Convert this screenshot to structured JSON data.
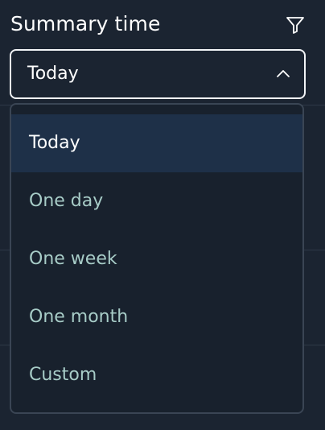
{
  "header": {
    "title": "Summary time",
    "filter_icon": "filter-icon"
  },
  "select": {
    "value": "Today",
    "state": "open",
    "chevron_icon": "chevron-up-icon"
  },
  "dropdown": {
    "options": [
      {
        "label": "Today",
        "selected": true
      },
      {
        "label": "One day",
        "selected": false
      },
      {
        "label": "One week",
        "selected": false
      },
      {
        "label": "One month",
        "selected": false
      },
      {
        "label": "Custom",
        "selected": false
      }
    ]
  },
  "colors": {
    "background": "#1b2431",
    "selected_option_bg": "#1e3048",
    "option_text": "#a7ccc7",
    "selected_text": "#ffffff",
    "select_border": "#f2f4f7"
  }
}
